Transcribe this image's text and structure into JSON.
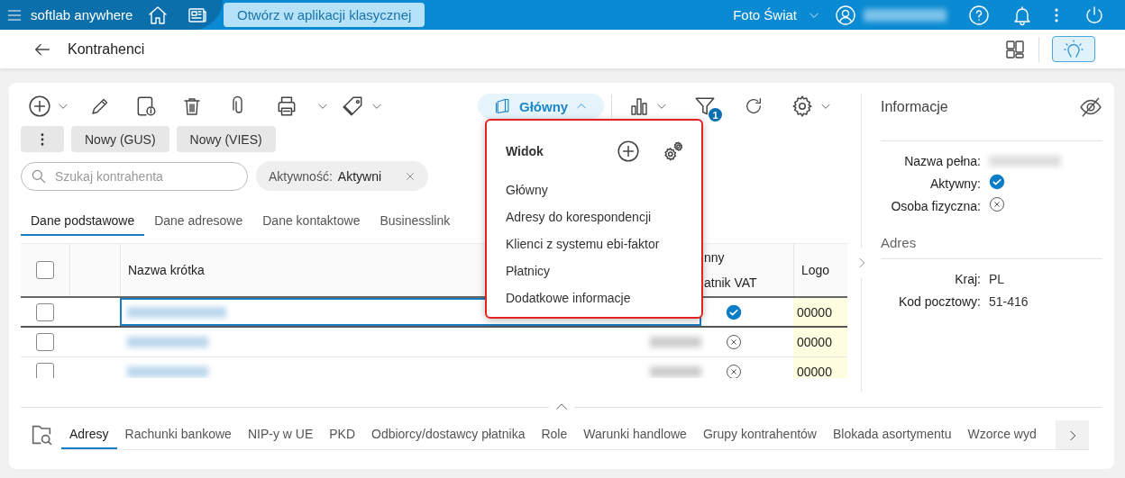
{
  "top_bar": {
    "app_name": "softlab anywhere",
    "open_classic_button": "Otwórz w aplikacji klasycznej",
    "company": "Foto Świat"
  },
  "header": {
    "title": "Kontrahenci"
  },
  "toolbar": {
    "view_button": "Główny",
    "filter_badge": "1",
    "action_buttons": [
      "Nowy (GUS)",
      "Nowy (VIES)"
    ]
  },
  "search": {
    "placeholder": "Szukaj kontrahenta"
  },
  "filter_chip": {
    "label": "Aktywność:",
    "value": "Aktywni"
  },
  "tabs": [
    {
      "label": "Dane podstawowe",
      "selected": true
    },
    {
      "label": "Dane adresowe",
      "selected": false
    },
    {
      "label": "Dane kontaktowe",
      "selected": false
    },
    {
      "label": "Businesslink",
      "selected": false
    }
  ],
  "table": {
    "select_all": false,
    "columns": [
      {
        "label": "Nazwa krótka"
      },
      {
        "label": "nny",
        "sublabel": "atnik VAT"
      },
      {
        "label": "Logo"
      }
    ],
    "rows": [
      {
        "selected": true,
        "checked": false,
        "vat": true,
        "logo": "00000"
      },
      {
        "selected": false,
        "checked": false,
        "vat": false,
        "logo": "00000"
      },
      {
        "selected": false,
        "checked": false,
        "vat": false,
        "logo": "00000"
      }
    ]
  },
  "view_menu": {
    "title": "Widok",
    "items": [
      "Główny",
      "Adresy do korespondencji",
      "Klienci z systemu ebi-faktor",
      "Płatnicy",
      "Dodatkowe informacje"
    ]
  },
  "info_panel": {
    "title": "Informacje",
    "fields": [
      {
        "label": "Nazwa pełna:",
        "kind": "blurred"
      },
      {
        "label": "Aktywny:",
        "kind": "flag",
        "on": true
      },
      {
        "label": "Osoba fizyczna:",
        "kind": "flag",
        "on": false
      }
    ],
    "address_title": "Adres",
    "address_fields": [
      {
        "label": "Kraj:",
        "value": "PL"
      },
      {
        "label": "Kod pocztowy:",
        "value": "51-416"
      }
    ]
  },
  "detail_tabs": [
    {
      "label": "Adresy",
      "selected": true
    },
    {
      "label": "Rachunki bankowe",
      "selected": false
    },
    {
      "label": "NIP-y w UE",
      "selected": false
    },
    {
      "label": "PKD",
      "selected": false
    },
    {
      "label": "Odbiorcy/dostawcy płatnika",
      "selected": false
    },
    {
      "label": "Role",
      "selected": false
    },
    {
      "label": "Warunki handlowe",
      "selected": false
    },
    {
      "label": "Grupy kontrahentów",
      "selected": false
    },
    {
      "label": "Blokada asortymentu",
      "selected": false
    },
    {
      "label": "Wzorce wyd",
      "selected": false
    }
  ]
}
